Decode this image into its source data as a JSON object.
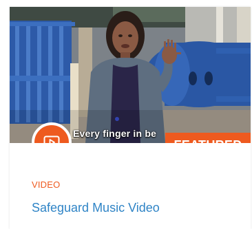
{
  "card": {
    "video_caption": "Every finger in be",
    "featured_label": "FEATURED",
    "type_label": "VIDEO",
    "title": "Safeguard Music Video"
  },
  "icons": {
    "play_badge": "play-icon"
  },
  "colors": {
    "accent": "#ee5a1f",
    "title_link": "#2f84c6"
  }
}
